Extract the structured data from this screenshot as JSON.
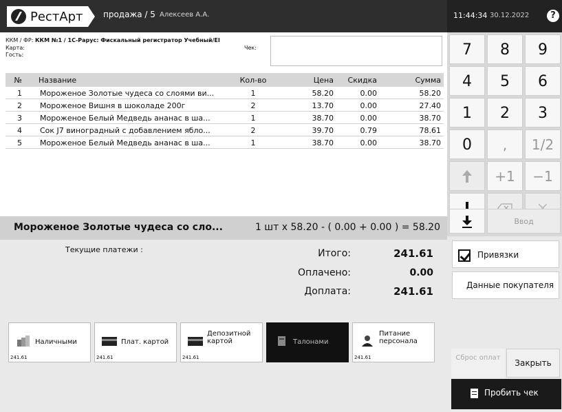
{
  "header": {
    "app_name": "РестАрт",
    "sale": "продажа / 5",
    "user": "Алексеев А.А.",
    "time": "11:44:34",
    "date": "30.12.2022",
    "help": "?"
  },
  "info": {
    "kkm_label": "ККМ / ФР:",
    "kkm_value": "ККМ №1 / 1С-Рарус: Фискальный регистратор Учебный/EI",
    "card_label": "Карта:",
    "guest_label": "Гость:",
    "check_label": "Чек:"
  },
  "table": {
    "headers": {
      "no": "№",
      "name": "Название",
      "qty": "Кол-во",
      "price": "Цена",
      "discount": "Скидка",
      "sum": "Сумма"
    },
    "rows": [
      {
        "no": "1",
        "name": "Мороженое Золотые чудеса со слоями ви...",
        "qty": "1",
        "price": "58.20",
        "discount": "0.00",
        "sum": "58.20"
      },
      {
        "no": "2",
        "name": "Мороженое Вишня в шоколаде 200г",
        "qty": "2",
        "price": "13.70",
        "discount": "0.00",
        "sum": "27.40"
      },
      {
        "no": "3",
        "name": "Мороженое Белый Медведь ананас в ша...",
        "qty": "1",
        "price": "38.70",
        "discount": "0.00",
        "sum": "38.70"
      },
      {
        "no": "4",
        "name": "Сок J7 виноградный с добавлением ябло...",
        "qty": "2",
        "price": "39.70",
        "discount": "0.79",
        "sum": "78.61"
      },
      {
        "no": "5",
        "name": "Мороженое Белый Медведь ананас в ша...",
        "qty": "1",
        "price": "38.70",
        "discount": "0.00",
        "sum": "38.70"
      }
    ]
  },
  "current": {
    "name": "Мороженое Золотые чудеса со сло...",
    "calc": "1 шт х 58.20 - ( 0.00 + 0.00 ) = 58.20"
  },
  "totals": {
    "payments_label": "Текущие платежи :",
    "total_label": "Итого:",
    "total_value": "241.61",
    "paid_label": "Оплачено:",
    "paid_value": "0.00",
    "due_label": "Доплата:",
    "due_value": "241.61"
  },
  "payment_methods": [
    {
      "label": "Наличными",
      "amount": "241.61",
      "icon": "coins-icon"
    },
    {
      "label": "Плат. картой",
      "amount": "241.61",
      "icon": "card-icon"
    },
    {
      "label": "Депозитной картой",
      "amount": "241.61",
      "icon": "card-icon"
    },
    {
      "label": "Талонами",
      "amount": "",
      "icon": "coupon-icon"
    },
    {
      "label": "Питание персонала",
      "amount": "241.61",
      "icon": "person-icon"
    }
  ],
  "keypad": {
    "k7": "7",
    "k8": "8",
    "k9": "9",
    "k4": "4",
    "k5": "5",
    "k6": "6",
    "k1": "1",
    "k2": "2",
    "k3": "3",
    "k0": "0",
    "comma": ",",
    "half": "1/2",
    "plus1": "+1",
    "minus1": "−1",
    "times": "×",
    "enter": "Ввод"
  },
  "actions": {
    "bindings": "Привязки",
    "customer_data": "Данные покупателя",
    "reset_payments": "Сброс оплат",
    "close": "Закрыть",
    "print_check": "Пробить чек"
  }
}
